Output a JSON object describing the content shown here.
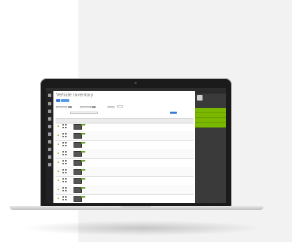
{
  "app": {
    "window_title": "",
    "page_title": "Vehicle Inventory",
    "primary_button": "",
    "secondary_button": "",
    "filters": {
      "status_label": "",
      "brand_label": "",
      "status_value": "",
      "brand_value": "",
      "filter_button": "",
      "search_label": "",
      "search_placeholder": ""
    },
    "table": {
      "columns": [
        "",
        "",
        "",
        "",
        "",
        "",
        "",
        "",
        "",
        "",
        "",
        ""
      ],
      "rows": [
        {
          "status": "active"
        },
        {
          "status": "active"
        },
        {
          "status": "active"
        },
        {
          "status": "active"
        },
        {
          "status": "active"
        },
        {
          "status": "active"
        },
        {
          "status": "active"
        },
        {
          "status": "active"
        },
        {
          "status": "active"
        }
      ]
    },
    "sidebar": {
      "user_name": "",
      "user_role": "",
      "items": [
        {
          "label": "",
          "count": ""
        },
        {
          "label": "",
          "count": ""
        },
        {
          "label": "",
          "count": ""
        },
        {
          "label": "",
          "count": ""
        }
      ],
      "note": ""
    }
  },
  "colors": {
    "accent_green": "#7ab800",
    "primary_blue": "#3a7bd5",
    "nav_dark": "#222222",
    "sidebar_dark": "#3a3a3a"
  }
}
